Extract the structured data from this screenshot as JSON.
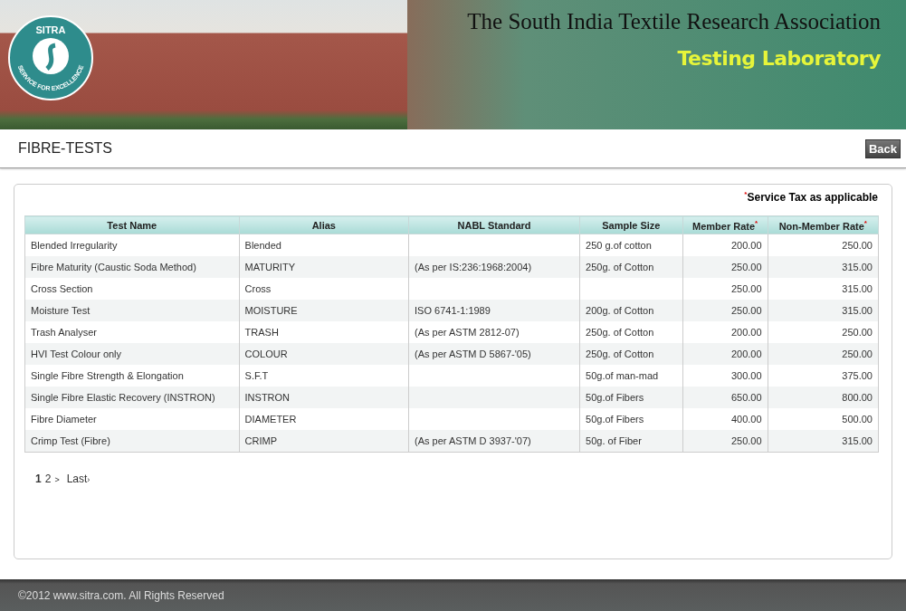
{
  "banner": {
    "logo": {
      "top": "SITRA",
      "ring": "SERVICE FOR EXCELLENCE"
    },
    "title": "The South India Textile Research Association",
    "subtitle": "Testing Laboratory"
  },
  "page": {
    "title": "FIBRE-TESTS",
    "back_button": "Back"
  },
  "note": {
    "mark": "*",
    "text": "Service Tax as applicable"
  },
  "table": {
    "columns": [
      {
        "label": "Test Name"
      },
      {
        "label": "Alias"
      },
      {
        "label": "NABL Standard"
      },
      {
        "label": "Sample Size"
      },
      {
        "label": "Member Rate",
        "mark": "*"
      },
      {
        "label": "Non-Member Rate",
        "mark": "*"
      }
    ],
    "rows": [
      [
        "Blended Irregularity",
        "Blended",
        "",
        "250 g.of cotton",
        "200.00",
        "250.00"
      ],
      [
        "Fibre Maturity (Caustic Soda Method)",
        "MATURITY",
        "(As per IS:236:1968:2004)",
        "250g. of Cotton",
        "250.00",
        "315.00"
      ],
      [
        "Cross Section",
        "Cross",
        "",
        "",
        "250.00",
        "315.00"
      ],
      [
        "Moisture Test",
        "MOISTURE",
        "ISO 6741-1:1989",
        "200g. of Cotton",
        "250.00",
        "315.00"
      ],
      [
        "Trash Analyser",
        "TRASH",
        "(As per ASTM 2812-07)",
        "250g. of Cotton",
        "200.00",
        "250.00"
      ],
      [
        "HVI Test Colour only",
        "COLOUR",
        "(As per ASTM D 5867-'05)",
        "250g. of Cotton",
        "200.00",
        "250.00"
      ],
      [
        "Single Fibre Strength & Elongation",
        "S.F.T",
        "",
        "50g.of man-mad",
        "300.00",
        "375.00"
      ],
      [
        "Single Fibre Elastic Recovery (INSTRON)",
        "INSTRON",
        "",
        "50g.of Fibers",
        "650.00",
        "800.00"
      ],
      [
        "Fibre Diameter",
        "DIAMETER",
        "",
        "50g.of Fibers",
        "400.00",
        "500.00"
      ],
      [
        "Crimp Test (Fibre)",
        "CRIMP",
        "(As per ASTM D 3937-'07)",
        "50g. of Fiber",
        "250.00",
        "315.00"
      ]
    ]
  },
  "pagination": {
    "pages": [
      {
        "label": "1",
        "selected": true
      },
      {
        "label": "2",
        "selected": false
      }
    ],
    "next": ">",
    "last": "Last",
    "last_arrow": "›"
  },
  "footer": "©2012 www.sitra.com. All Rights Reserved"
}
